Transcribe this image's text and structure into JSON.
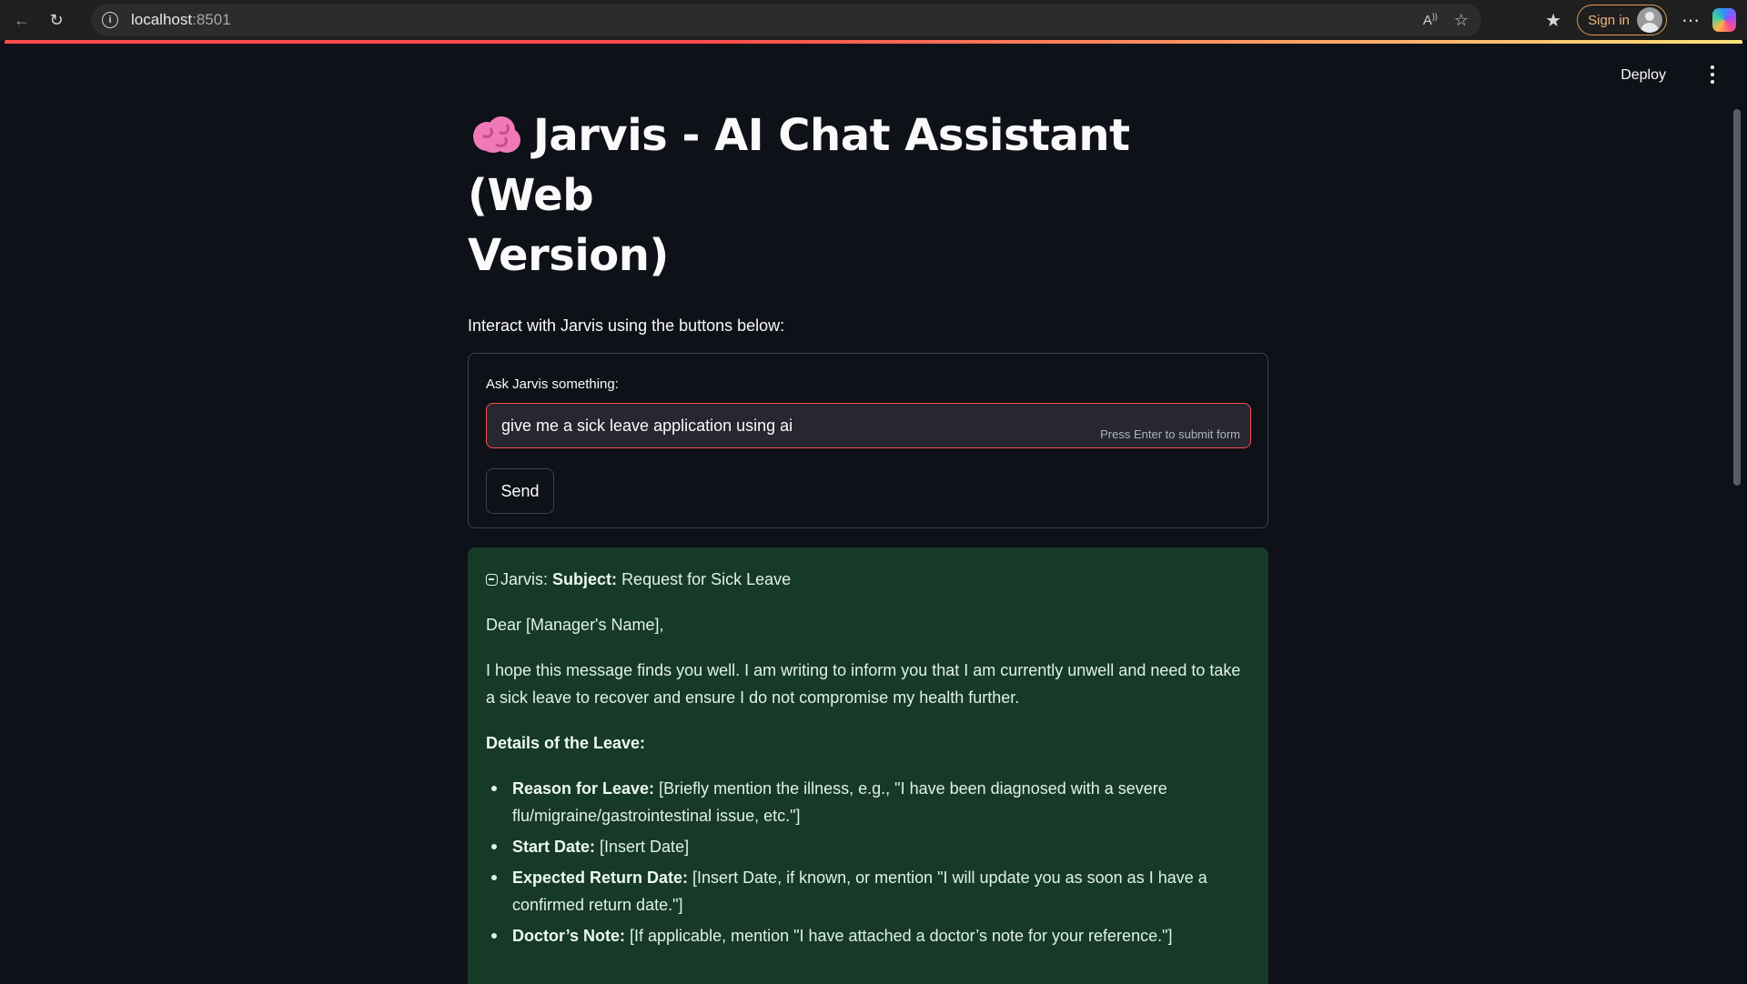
{
  "browser": {
    "url_host": "localhost",
    "url_port": ":8501",
    "signin_label": "Sign in"
  },
  "header": {
    "deploy_label": "Deploy"
  },
  "main": {
    "title_line1": "Jarvis - AI Chat Assistant (Web",
    "title_line2": "Version)",
    "subtitle": "Interact with Jarvis using the buttons below:"
  },
  "form": {
    "label": "Ask Jarvis something:",
    "input_value": "give me a sick leave application using ai",
    "hint": "Press Enter to submit form",
    "send_label": "Send"
  },
  "response": {
    "speaker": "Jarvis:",
    "subject_label": "Subject:",
    "subject_text": "Request for Sick Leave",
    "greeting": "Dear [Manager's Name],",
    "body": "I hope this message finds you well. I am writing to inform you that I am currently unwell and need to take a sick leave to recover and ensure I do not compromise my health further.",
    "details_heading": "Details of the Leave:",
    "details": [
      {
        "label": "Reason for Leave:",
        "text": " [Briefly mention the illness, e.g., \"I have been diagnosed with a severe flu/migraine/gastrointestinal issue, etc.\"]"
      },
      {
        "label": "Start Date:",
        "text": " [Insert Date]"
      },
      {
        "label": "Expected Return Date:",
        "text": " [Insert Date, if known, or mention \"I will update you as soon as I have a confirmed return date.\"]"
      },
      {
        "label": "Doctor’s Note:",
        "text": " [If applicable, mention \"I have attached a doctor’s note for your reference.\"]"
      }
    ]
  }
}
